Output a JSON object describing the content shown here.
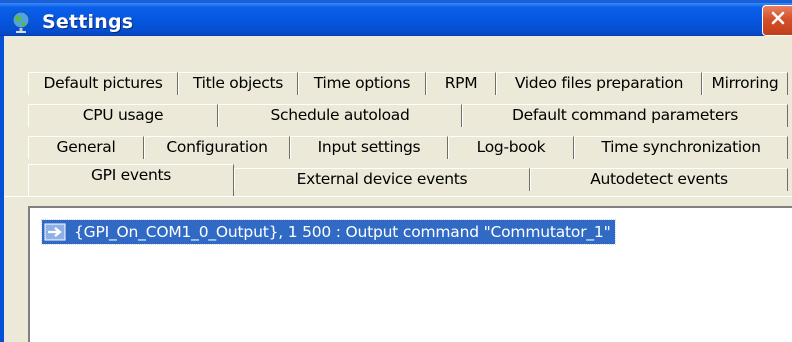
{
  "window": {
    "title": "Settings"
  },
  "tabs": {
    "row1": [
      "Default pictures",
      "Title objects",
      "Time options",
      "RPM",
      "Video files preparation",
      "Mirroring"
    ],
    "row2": [
      "CPU usage",
      "Schedule autoload",
      "Default command parameters"
    ],
    "row3": [
      "General",
      "Configuration",
      "Input settings",
      "Log-book",
      "Time synchronization"
    ],
    "row4": [
      "GPI events",
      "External device events",
      "Autodetect events"
    ],
    "active": "GPI events"
  },
  "events": [
    {
      "icon": "arrow-right-icon",
      "text": "{GPI_On_COM1_0_Output}, 1 500 : Output command \"Commutator_1\"",
      "selected": true
    }
  ],
  "colors": {
    "titlebar": "#0657e0",
    "selection": "#316ac5",
    "close": "#d4502a",
    "face": "#ece9d8"
  }
}
